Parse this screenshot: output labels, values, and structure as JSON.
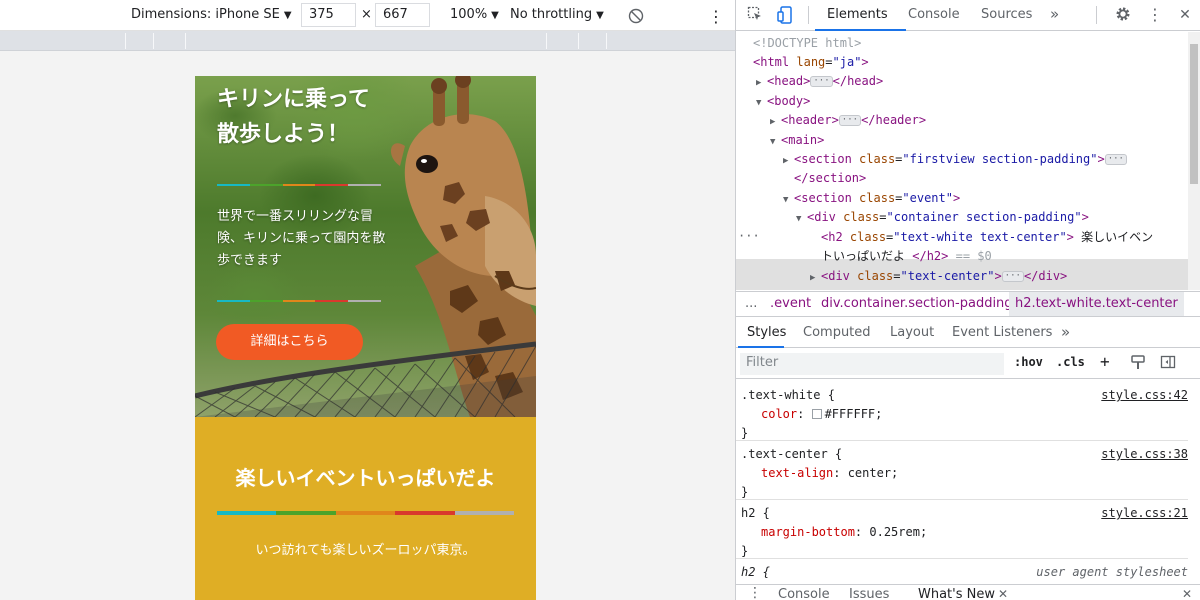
{
  "device_toolbar": {
    "dimensions_label": "Dimensions: iPhone SE",
    "width": "375",
    "times": "×",
    "height": "667",
    "zoom": "100%",
    "throttling": "No throttling"
  },
  "page": {
    "hero_title_line1": "キリンに乗って",
    "hero_title_line2": "散歩しよう！",
    "hero_text": "世界で一番スリリングな冒険、キリンに乗って園内を散歩できます",
    "cta_label": "詳細はこちら",
    "event_title": "楽しいイベントいっぱいだよ",
    "event_text": "いつ訪れても楽しいズーロッパ東京。",
    "rainbow_colors": [
      "#17b9c4",
      "#4ca32b",
      "#e0861b",
      "#d9392d",
      "#b0b0b0"
    ],
    "cta_color": "#f15a24",
    "event_bg": "#dfae25"
  },
  "devtools": {
    "tabs": [
      "Elements",
      "Console",
      "Sources"
    ],
    "active_tab": "Elements",
    "more_tabs": "»",
    "dom": {
      "doctype": "<!DOCTYPE html>",
      "html_tag": "html",
      "html_attr": "lang",
      "html_val": "\"ja\"",
      "head_open": "<head>",
      "head_close": "</head>",
      "body_open": "<body>",
      "header_open": "<header>",
      "header_close": "</header>",
      "main_open": "<main>",
      "section_tag": "section",
      "class_attr": "class",
      "section1_class": "\"firstview section-padding\"",
      "section1_close": "</section>",
      "section2_class": "\"event\"",
      "div_tag": "div",
      "div_class": "\"container section-padding\"",
      "h2_tag": "h2",
      "h2_class": "\"text-white text-center\"",
      "h2_text1": "楽しいイベン",
      "h2_text2": "トいっぱいだよ",
      "h2_close": "</h2>",
      "sel_marker": "== $0",
      "div2_class": "\"text-center\"",
      "div2_close": "</div>",
      "gutter_dots": "···"
    },
    "breadcrumbs": [
      "...",
      ".event",
      "div.container.section-padding",
      "h2.text-white.text-center"
    ],
    "styles_tabs": [
      "Styles",
      "Computed",
      "Layout",
      "Event Listeners"
    ],
    "styles_more": "»",
    "filter_placeholder": "Filter",
    "filter_hov": ":hov",
    "filter_cls": ".cls",
    "filter_plus": "+",
    "rules": [
      {
        "selector": ".text-white {",
        "prop": "color",
        "value": "#FFFFFF;",
        "source": "style.css:42",
        "close": "}"
      },
      {
        "selector": ".text-center {",
        "prop": "text-align",
        "value": "center;",
        "source": "style.css:38",
        "close": "}"
      },
      {
        "selector": "h2 {",
        "prop": "margin-bottom",
        "value": "0.25rem;",
        "source": "style.css:21",
        "close": "}"
      },
      {
        "selector": "h2 {",
        "source": "user agent stylesheet"
      }
    ],
    "drawer_tabs": [
      "Console",
      "Issues",
      "What's New"
    ],
    "drawer_close": "✕"
  }
}
